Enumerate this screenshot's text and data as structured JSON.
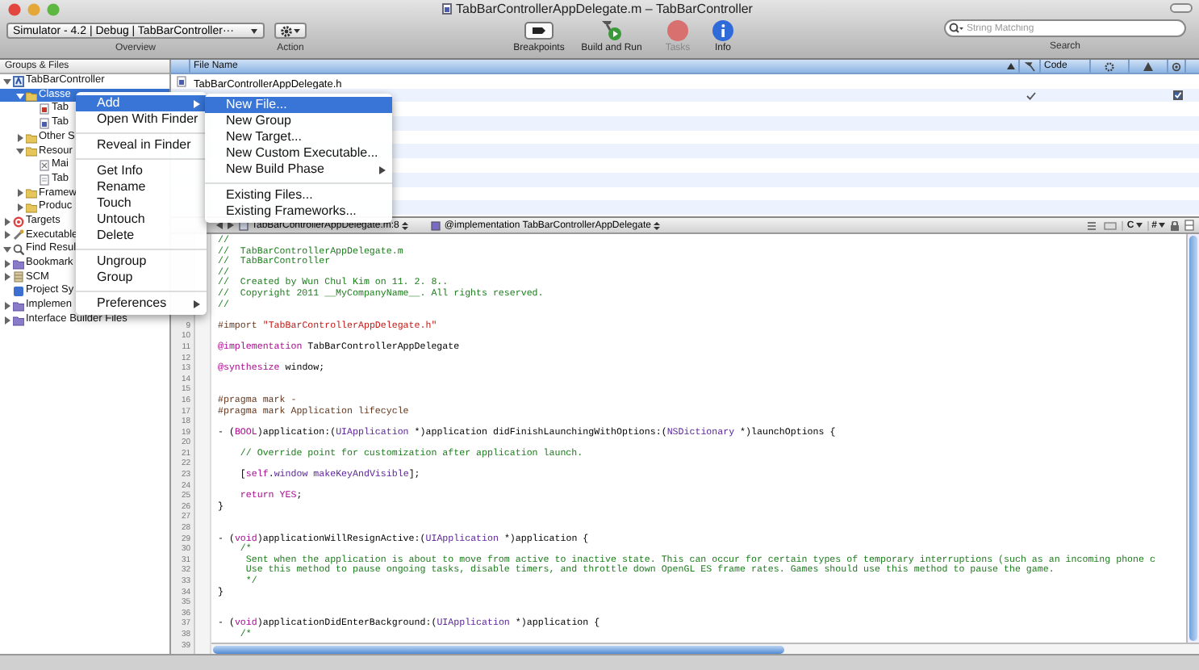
{
  "window": {
    "title": "TabBarControllerAppDelegate.m – TabBarController"
  },
  "toolbar": {
    "overview": {
      "value": "Simulator - 4.2 | Debug | TabBarController···",
      "label": "Overview"
    },
    "action": {
      "label": "Action"
    },
    "buttons": [
      {
        "kind": "breakpoints",
        "label": "Breakpoints",
        "disabled": false
      },
      {
        "kind": "build",
        "label": "Build and Run",
        "disabled": false
      },
      {
        "kind": "tasks",
        "label": "Tasks",
        "disabled": true
      },
      {
        "kind": "info",
        "label": "Info",
        "disabled": false
      }
    ],
    "search": {
      "placeholder": "String Matching",
      "label": "Search"
    }
  },
  "sidebar": {
    "header": "Groups & Files",
    "items": [
      {
        "label": "TabBarController",
        "kind": "project",
        "expanded": true,
        "selected": false,
        "children": [
          {
            "label": "Classe",
            "kind": "folder",
            "expanded": true,
            "selected": true,
            "children": [
              {
                "label": "Tab",
                "kind": "m-file",
                "selected": false
              },
              {
                "label": "Tab",
                "kind": "h-file",
                "selected": false
              }
            ]
          },
          {
            "label": "Other S",
            "kind": "folder",
            "expanded": false,
            "selected": false
          },
          {
            "label": "Resour",
            "kind": "folder",
            "expanded": true,
            "selected": false,
            "children": [
              {
                "label": "Mai",
                "kind": "xib-file",
                "selected": false
              },
              {
                "label": "Tab",
                "kind": "plist-file",
                "selected": false
              }
            ]
          },
          {
            "label": "Framew",
            "kind": "folder",
            "expanded": false,
            "selected": false
          },
          {
            "label": "Produc",
            "kind": "folder",
            "expanded": false,
            "selected": false
          }
        ]
      },
      {
        "label": "Targets",
        "kind": "target",
        "expanded": false,
        "selected": false
      },
      {
        "label": "Executable",
        "kind": "executable",
        "expanded": false,
        "selected": false
      },
      {
        "label": "Find Resul",
        "kind": "find",
        "expanded": true,
        "selected": false
      },
      {
        "label": "Bookmark",
        "kind": "smart",
        "expanded": false,
        "selected": false
      },
      {
        "label": "SCM",
        "kind": "scm",
        "expanded": false,
        "selected": false
      },
      {
        "label": "Project Sy",
        "kind": "symbols",
        "selected": false
      },
      {
        "label": "Implemen",
        "kind": "smart",
        "expanded": false,
        "selected": false
      },
      {
        "label": "Interface Builder Files",
        "kind": "smart",
        "expanded": false,
        "selected": false
      }
    ]
  },
  "file_list": {
    "columns": [
      {
        "label": "File Name",
        "sorted": true
      },
      {
        "label": "Code"
      }
    ],
    "rows": [
      {
        "name": "TabBarControllerAppDelegate.h",
        "kind": "h-file"
      },
      {
        "built": true,
        "target": true
      }
    ]
  },
  "context_menu": {
    "items": [
      {
        "kind": "item",
        "label": "Add",
        "selected": true,
        "submenu": true
      },
      {
        "kind": "item",
        "label": "Open With Finder",
        "selected": false,
        "submenu": false
      },
      {
        "kind": "separator"
      },
      {
        "kind": "item",
        "label": "Reveal in Finder",
        "selected": false,
        "submenu": false
      },
      {
        "kind": "separator"
      },
      {
        "kind": "item",
        "label": "Get Info",
        "selected": false,
        "submenu": false
      },
      {
        "kind": "item",
        "label": "Rename",
        "selected": false,
        "submenu": false
      },
      {
        "kind": "item",
        "label": "Touch",
        "selected": false,
        "submenu": false
      },
      {
        "kind": "item",
        "label": "Untouch",
        "selected": false,
        "submenu": false
      },
      {
        "kind": "item",
        "label": "Delete",
        "selected": false,
        "submenu": false
      },
      {
        "kind": "separator"
      },
      {
        "kind": "item",
        "label": "Ungroup",
        "selected": false,
        "submenu": false
      },
      {
        "kind": "item",
        "label": "Group",
        "selected": false,
        "submenu": false
      },
      {
        "kind": "separator"
      },
      {
        "kind": "item",
        "label": "Preferences",
        "selected": false,
        "submenu": true
      }
    ]
  },
  "submenu": {
    "items": [
      {
        "kind": "item",
        "label": "New File...",
        "selected": true,
        "submenu": false
      },
      {
        "kind": "item",
        "label": "New Group",
        "selected": false,
        "submenu": false
      },
      {
        "kind": "item",
        "label": "New Target...",
        "selected": false,
        "submenu": false
      },
      {
        "kind": "item",
        "label": "New Custom Executable...",
        "selected": false,
        "submenu": false
      },
      {
        "kind": "item",
        "label": "New Build Phase",
        "selected": false,
        "submenu": true
      },
      {
        "kind": "separator"
      },
      {
        "kind": "item",
        "label": "Existing Files...",
        "selected": false,
        "submenu": false
      },
      {
        "kind": "item",
        "label": "Existing Frameworks...",
        "selected": false,
        "submenu": false
      }
    ]
  },
  "editor": {
    "file_popup": "TabBarControllerAppDelegate.m:8",
    "symbol_popup": "@implementation TabBarControllerAppDelegate",
    "tools": [
      "C",
      "#"
    ],
    "lines": [
      {
        "tokens": [
          {
            "kind": "comment",
            "text": "//"
          }
        ]
      },
      {
        "tokens": [
          {
            "kind": "comment",
            "text": "//  TabBarControllerAppDelegate.m"
          }
        ]
      },
      {
        "tokens": [
          {
            "kind": "comment",
            "text": "//  TabBarController"
          }
        ]
      },
      {
        "tokens": [
          {
            "kind": "comment",
            "text": "//"
          }
        ]
      },
      {
        "tokens": [
          {
            "kind": "comment",
            "text": "//  Created by Wun Chul Kim on 11. 2. 8.."
          }
        ]
      },
      {
        "tokens": [
          {
            "kind": "comment",
            "text": "//  Copyright 2011 __MyCompanyName__. All rights reserved."
          }
        ]
      },
      {
        "tokens": [
          {
            "kind": "comment",
            "text": "//"
          }
        ]
      },
      {
        "kind": "blank"
      },
      {
        "number": "9",
        "tokens": [
          {
            "kind": "directive",
            "text": "#import "
          },
          {
            "kind": "string",
            "text": "\"TabBarControllerAppDelegate.h\""
          }
        ]
      },
      {
        "number": "10"
      },
      {
        "number": "11",
        "tokens": [
          {
            "kind": "keyword",
            "text": "@implementation"
          },
          {
            "kind": "plain",
            "text": " TabBarControllerAppDelegate"
          }
        ]
      },
      {
        "number": "12"
      },
      {
        "number": "13",
        "tokens": [
          {
            "kind": "keyword",
            "text": "@synthesize"
          },
          {
            "kind": "plain",
            "text": " window;"
          }
        ]
      },
      {
        "number": "14"
      },
      {
        "number": "15"
      },
      {
        "number": "16",
        "tokens": [
          {
            "kind": "directive",
            "text": "#pragma mark -"
          }
        ]
      },
      {
        "number": "17",
        "tokens": [
          {
            "kind": "directive",
            "text": "#pragma mark Application lifecycle"
          }
        ]
      },
      {
        "number": "18"
      },
      {
        "number": "19",
        "tokens": [
          {
            "kind": "plain",
            "text": "- ("
          },
          {
            "kind": "keyword",
            "text": "BOOL"
          },
          {
            "kind": "plain",
            "text": ")application:("
          },
          {
            "kind": "type",
            "text": "UIApplication"
          },
          {
            "kind": "plain",
            "text": " *)application didFinishLaunchingWithOptions:("
          },
          {
            "kind": "type",
            "text": "NSDictionary"
          },
          {
            "kind": "plain",
            "text": " *)launchOptions {"
          }
        ]
      },
      {
        "number": "20"
      },
      {
        "number": "21",
        "tokens": [
          {
            "kind": "comment",
            "text": "    // Override point for customization after application launch."
          }
        ]
      },
      {
        "number": "22"
      },
      {
        "number": "23",
        "tokens": [
          {
            "kind": "plain",
            "text": "    ["
          },
          {
            "kind": "keyword",
            "text": "self"
          },
          {
            "kind": "plain",
            "text": "."
          },
          {
            "kind": "type",
            "text": "window"
          },
          {
            "kind": "type",
            "text": " makeKeyAndVisible"
          },
          {
            "kind": "plain",
            "text": "];"
          }
        ]
      },
      {
        "number": "24"
      },
      {
        "number": "25",
        "tokens": [
          {
            "kind": "keyword",
            "text": "    return"
          },
          {
            "kind": "keyword",
            "text": " YES"
          },
          {
            "kind": "plain",
            "text": ";"
          }
        ]
      },
      {
        "number": "26",
        "tokens": [
          {
            "kind": "plain",
            "text": "}"
          }
        ]
      },
      {
        "number": "27"
      },
      {
        "number": "28"
      },
      {
        "number": "29",
        "tokens": [
          {
            "kind": "plain",
            "text": "- ("
          },
          {
            "kind": "keyword",
            "text": "void"
          },
          {
            "kind": "plain",
            "text": ")applicationWillResignActive:("
          },
          {
            "kind": "type",
            "text": "UIApplication"
          },
          {
            "kind": "plain",
            "text": " *)application {"
          }
        ]
      },
      {
        "number": "30",
        "tokens": [
          {
            "kind": "comment",
            "text": "    /*"
          }
        ]
      },
      {
        "number": "31",
        "tokens": [
          {
            "kind": "comment",
            "text": "     Sent when the application is about to move from active to inactive state. This can occur for certain types of temporary interruptions (such as an incoming phone c"
          }
        ]
      },
      {
        "number": "32",
        "tokens": [
          {
            "kind": "comment",
            "text": "     Use this method to pause ongoing tasks, disable timers, and throttle down OpenGL ES frame rates. Games should use this method to pause the game."
          }
        ]
      },
      {
        "number": "33",
        "tokens": [
          {
            "kind": "comment",
            "text": "     */"
          }
        ]
      },
      {
        "number": "34",
        "tokens": [
          {
            "kind": "plain",
            "text": "}"
          }
        ]
      },
      {
        "number": "35"
      },
      {
        "number": "36"
      },
      {
        "number": "37",
        "tokens": [
          {
            "kind": "plain",
            "text": "- ("
          },
          {
            "kind": "keyword",
            "text": "void"
          },
          {
            "kind": "plain",
            "text": ")applicationDidEnterBackground:("
          },
          {
            "kind": "type",
            "text": "UIApplication"
          },
          {
            "kind": "plain",
            "text": " *)application {"
          }
        ]
      },
      {
        "number": "38",
        "tokens": [
          {
            "kind": "comment",
            "text": "    /*"
          }
        ]
      },
      {
        "number": "39"
      }
    ]
  }
}
